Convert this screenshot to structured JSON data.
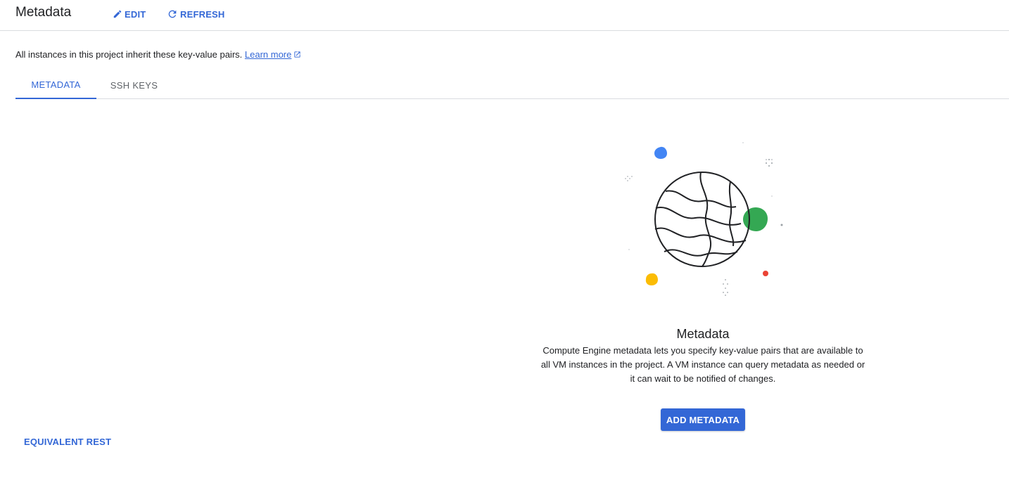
{
  "header": {
    "title": "Metadata",
    "edit_label": "EDIT",
    "refresh_label": "REFRESH",
    "edit_icon": "pencil-icon",
    "refresh_icon": "refresh-icon"
  },
  "info": {
    "text": "All instances in this project inherit these key-value pairs.",
    "link_label": "Learn more",
    "link_icon": "open-in-new-icon"
  },
  "tabs": [
    {
      "label": "METADATA",
      "active": true
    },
    {
      "label": "SSH KEYS",
      "active": false
    }
  ],
  "empty_state": {
    "illustration": "globe-illustration",
    "title": "Metadata",
    "description": "Compute Engine metadata lets you specify key-value pairs that are available to all VM instances in the project. A VM instance can query metadata as needed or it can wait to be notified of changes.",
    "button_label": "ADD METADATA"
  },
  "footer": {
    "equivalent_rest_label": "EQUIVALENT REST"
  },
  "colors": {
    "accent": "#3367d6",
    "text": "#202124",
    "muted": "#5f6368",
    "divider": "#dadce0",
    "google_blue": "#4285f4",
    "google_green": "#34a853",
    "google_yellow": "#fbbc04",
    "google_red": "#ea4335"
  }
}
